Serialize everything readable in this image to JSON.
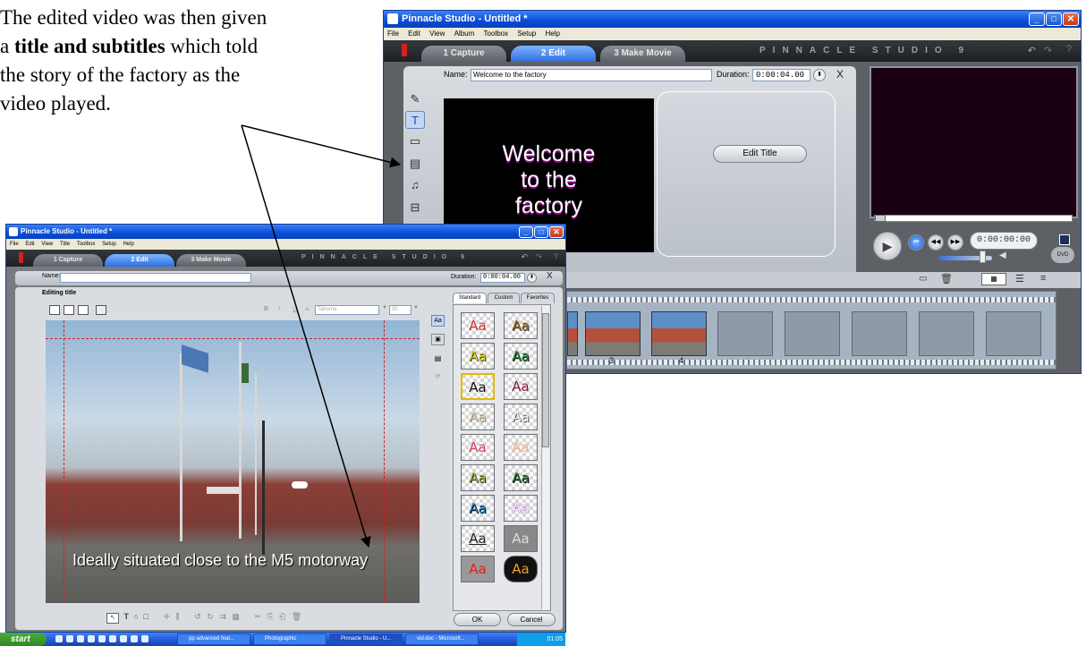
{
  "caption": {
    "line1": "The edited video was then given",
    "line2_pre": "a ",
    "line2_bold": "title and subtitles",
    "line2_post": " which told",
    "line3": "the story of the factory as the",
    "line4": "video played."
  },
  "back_window": {
    "title": "Pinnacle Studio - Untitled *",
    "menu": [
      "File",
      "Edit",
      "View",
      "Album",
      "Toolbox",
      "Setup",
      "Help"
    ],
    "tabs": [
      "1 Capture",
      "2 Edit",
      "3 Make Movie"
    ],
    "brand": "PINNACLE STUDIO 9",
    "name_label": "Name:",
    "name_value": "Welcome to the factory",
    "duration_label": "Duration:",
    "duration_value": "0:00:04.00",
    "close_glyph": "X",
    "preview_lines": [
      "Welcome",
      "to the",
      "factory"
    ],
    "edit_title_button": "Edit Title",
    "timecode": "0:00:00:00",
    "thumbnails": [
      {
        "number": "3"
      },
      {
        "number": "4"
      }
    ]
  },
  "front_window": {
    "title": "Pinnacle Studio - Untitled *",
    "menu": [
      "File",
      "Edit",
      "View",
      "Title",
      "Toolbox",
      "Setup",
      "Help"
    ],
    "tabs": [
      "1 Capture",
      "2 Edit",
      "3 Make Movie"
    ],
    "brand": "PINNACLE STUDIO 9",
    "name_label": "Name:",
    "name_value": "",
    "duration_label": "Duration:",
    "duration_value": "0:00:04.00",
    "close_glyph": "X",
    "editing_heading": "Editing title",
    "font_name": "Tahoma",
    "font_size": "30",
    "style_tabs": [
      "Standard",
      "Custom",
      "Favorites"
    ],
    "swatch_text": "Aa",
    "subtitle": "Ideally situated close to the M5 motorway",
    "ok_button": "OK",
    "cancel_button": "Cancel"
  },
  "taskbar": {
    "start": "start",
    "tasks": [
      "pp advanced feat...",
      "Photographic",
      "Pinnacle Studio - U...",
      "vid.doc - Microsoft..."
    ],
    "clock": "01:05"
  },
  "colors": {
    "titlebar_blue": "#0a4cd8",
    "studio_grey": "#5d6166",
    "arrow": "#000000"
  }
}
